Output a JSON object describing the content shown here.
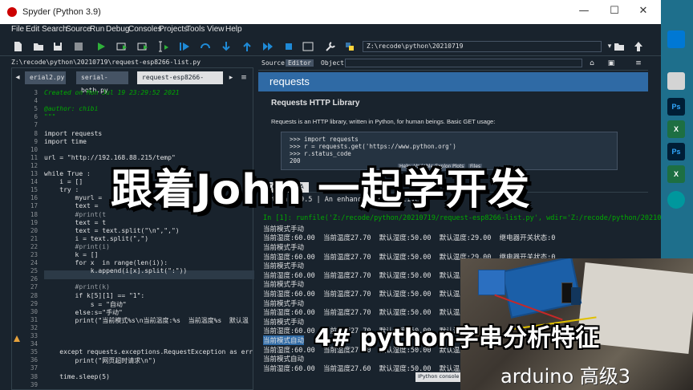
{
  "window": {
    "title": "Spyder (Python 3.9)",
    "controls": [
      "—",
      "☐",
      "✕"
    ]
  },
  "menu": [
    "File",
    "Edit",
    "Search",
    "Source",
    "Run",
    "Debug",
    "Consoles",
    "Projects",
    "Tools",
    "View",
    "Help"
  ],
  "toolbar": {
    "working_dir": "Z:\\recode\\python\\20210719"
  },
  "editor": {
    "file_path": "Z:\\recode\\python\\20210719\\request-esp8266-list.py",
    "tabs": [
      "erial2.py",
      "serial-both.py",
      "request-esp8266-list.py"
    ],
    "active_tab": 2,
    "lines": [
      {
        "n": "3",
        "t": "Created on Mon Jul 19 23:29:52 2021",
        "c": "#00aa00",
        "i": true
      },
      {
        "n": "4",
        "t": "",
        "c": "#e0e1e3"
      },
      {
        "n": "5",
        "t": "@author: chibi",
        "c": "#00aa00",
        "i": true
      },
      {
        "n": "6",
        "t": "\"\"\"",
        "c": "#00aa00"
      },
      {
        "n": "7",
        "t": "",
        "c": "#e0e1e3"
      },
      {
        "n": "8",
        "t": "import requests",
        "c": "#e0e1e3"
      },
      {
        "n": "9",
        "t": "import time",
        "c": "#e0e1e3"
      },
      {
        "n": "10",
        "t": "",
        "c": "#e0e1e3"
      },
      {
        "n": "11",
        "t": "url = \"http://192.168.88.215/temp\"",
        "c": "#e0e1e3"
      },
      {
        "n": "12",
        "t": "",
        "c": "#e0e1e3"
      },
      {
        "n": "13",
        "t": "while True :",
        "c": "#e0e1e3"
      },
      {
        "n": "14",
        "t": "    i = []",
        "c": "#e0e1e3"
      },
      {
        "n": "15",
        "t": "    try :",
        "c": "#e0e1e3"
      },
      {
        "n": "16",
        "t": "        myurl =",
        "c": "#e0e1e3"
      },
      {
        "n": "17",
        "t": "        text =",
        "c": "#e0e1e3"
      },
      {
        "n": "18",
        "t": "        #print(t",
        "c": "#9aa0a6"
      },
      {
        "n": "19",
        "t": "        text = t",
        "c": "#e0e1e3"
      },
      {
        "n": "20",
        "t": "        text = text.split(\"\\n\",\",\")",
        "c": "#e0e1e3"
      },
      {
        "n": "21",
        "t": "        i = text.split(\",\")",
        "c": "#e0e1e3"
      },
      {
        "n": "22",
        "t": "        #print(i)",
        "c": "#9aa0a6"
      },
      {
        "n": "23",
        "t": "        k = []",
        "c": "#e0e1e3"
      },
      {
        "n": "24",
        "t": "        for x  in range(len(i)):",
        "c": "#e0e1e3"
      },
      {
        "n": "25",
        "t": "            k.append(i[x].split(\":\"))",
        "c": "#e0e1e3"
      },
      {
        "n": "26",
        "t": "",
        "c": "#e0e1e3"
      },
      {
        "n": "27",
        "t": "        #print(k)",
        "c": "#9aa0a6"
      },
      {
        "n": "28",
        "t": "        if k[5][1] == \"1\":",
        "c": "#e0e1e3"
      },
      {
        "n": "29",
        "t": "            s = \"自动\"",
        "c": "#e0e1e3"
      },
      {
        "n": "30",
        "t": "        else:s=\"手动\"",
        "c": "#e0e1e3"
      },
      {
        "n": "31",
        "t": "        print(\"当前模式%s\\n当前温度:%s  当前温度%s  默认温",
        "c": "#e0e1e3"
      },
      {
        "n": "32",
        "t": "",
        "c": "#e0e1e3"
      },
      {
        "n": "33",
        "t": "",
        "c": "#e0e1e3"
      },
      {
        "n": "34",
        "t": "",
        "c": "#e0e1e3"
      },
      {
        "n": "35",
        "t": "    except requests.exceptions.RequestException as err",
        "c": "#e0e1e3"
      },
      {
        "n": "36",
        "t": "        print(\"网页超时请求\\n\")",
        "c": "#e0e1e3"
      },
      {
        "n": "37",
        "t": "",
        "c": "#e0e1e3"
      },
      {
        "n": "38",
        "t": "    time.sleep(5)",
        "c": "#e0e1e3"
      },
      {
        "n": "39",
        "t": "",
        "c": "#e0e1e3"
      }
    ]
  },
  "help": {
    "source_label": "Source",
    "editor_label": "Editor",
    "object_label": "Object",
    "header": "requests",
    "heading": "Requests HTTP Library",
    "desc": "Requests is an HTTP library, written in Python, for human beings. Basic GET usage:",
    "example": [
      ">>> import requests",
      ">>> r = requests.get('https://www.python.org')",
      ">>> r.status_code",
      "200"
    ],
    "pane_tabs": [
      "Help",
      "Variable Explorer",
      "Plots",
      "Files"
    ]
  },
  "console": {
    "tab": "Console 1/A",
    "lines": [
      {
        "t": "Python 3.9.5 | An enhanced Interactive",
        "k": "plain"
      },
      {
        "t": "",
        "k": "plain"
      },
      {
        "t": "In [1]: runfile('Z:/recode/python/20210719/request-esp8266-list.py', wdir='Z:/recode/python/20210719')",
        "k": "in"
      },
      {
        "t": "当前模式手动",
        "k": "plain"
      },
      {
        "t": "当前湿度:60.00  当前温度27.70  默认湿度:50.00  默认温度:29.00  继电器开关状态:0",
        "k": "plain"
      },
      {
        "t": "当前模式手动",
        "k": "plain"
      },
      {
        "t": "当前湿度:60.00  当前温度27.70  默认湿度:50.00  默认温度:29.00  继电器开关状态:0",
        "k": "plain"
      },
      {
        "t": "当前模式手动",
        "k": "plain"
      },
      {
        "t": "当前湿度:60.00  当前温度27.70  默认湿度:50.00  默认温度:29.00  继电器开关状态:0",
        "k": "plain"
      },
      {
        "t": "当前模式手动",
        "k": "plain"
      },
      {
        "t": "当前湿度:60.00  当前温度27.70  默认湿度:50.00  默认温度:29.00  继电器开关状态:0",
        "k": "plain"
      },
      {
        "t": "当前模式手动",
        "k": "plain"
      },
      {
        "t": "当前湿度:60.00  当前温度27.70  默认湿度:50.00  默认温度:29.00  继电器开关状态:0",
        "k": "plain"
      },
      {
        "t": "当前模式手动",
        "k": "plain"
      },
      {
        "t": "当前湿度:60.00  当前温度27.70  默认湿度:50.00  默认温度:29.00  继电器开关状态:0",
        "k": "plain"
      },
      {
        "t": "当前模式自动",
        "k": "sel"
      },
      {
        "t": "当前湿度:60.00  当前温度27.60  默认湿度:50.00  默认温度:29.00  继电器开关状态:0",
        "k": "plain"
      },
      {
        "t": "当前模式自动",
        "k": "plain"
      },
      {
        "t": "当前湿度:60.00  当前温度27.60  默认湿度:50.00  默认温度:29.00  继电器开关状态:0",
        "k": "plain"
      }
    ],
    "ipython_tab": "IPython console"
  },
  "taskbar_icons": [
    {
      "name": "Ps",
      "bg": "#001e36",
      "fg": "#31a8ff"
    },
    {
      "name": "X",
      "bg": "#1d6f42",
      "fg": "#ffffff"
    },
    {
      "name": "Ps",
      "bg": "#001e36",
      "fg": "#31a8ff"
    },
    {
      "name": "X",
      "bg": "#1d6f42",
      "fg": "#ffffff"
    }
  ],
  "overlay": {
    "title": "跟着John 一起学开发",
    "subtitle": "4# python字串分析特征",
    "brand": "arduino 高级3"
  },
  "colors": {
    "accent": "#2f6aa5",
    "background": "#19232d",
    "taskbar": "#1e6f8c"
  }
}
